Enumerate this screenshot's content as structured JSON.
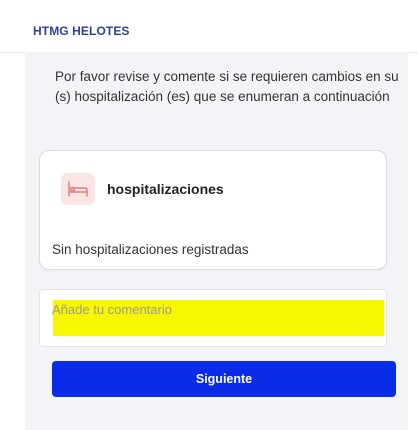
{
  "header": {
    "title": "HTMG HELOTES"
  },
  "intro": {
    "text": "Por favor revise y comente si se requieren cambios en su (s) hospitalización (es) que se enumeran a continuación"
  },
  "hospitalizations_card": {
    "icon": "hospital-bed-icon",
    "title": "hospitalizaciones",
    "empty_text": "Sin hospitalizaciones registradas"
  },
  "comment": {
    "placeholder": "Añade tu comentario",
    "value": ""
  },
  "actions": {
    "next_label": "Siguiente"
  },
  "colors": {
    "header_title": "#2f3f95",
    "primary_button": "#0a2ce8",
    "icon_background": "#fbe5e5",
    "icon_stroke": "#e27b7b",
    "highlight": "#f7f700",
    "content_background": "#f3f4f7"
  }
}
